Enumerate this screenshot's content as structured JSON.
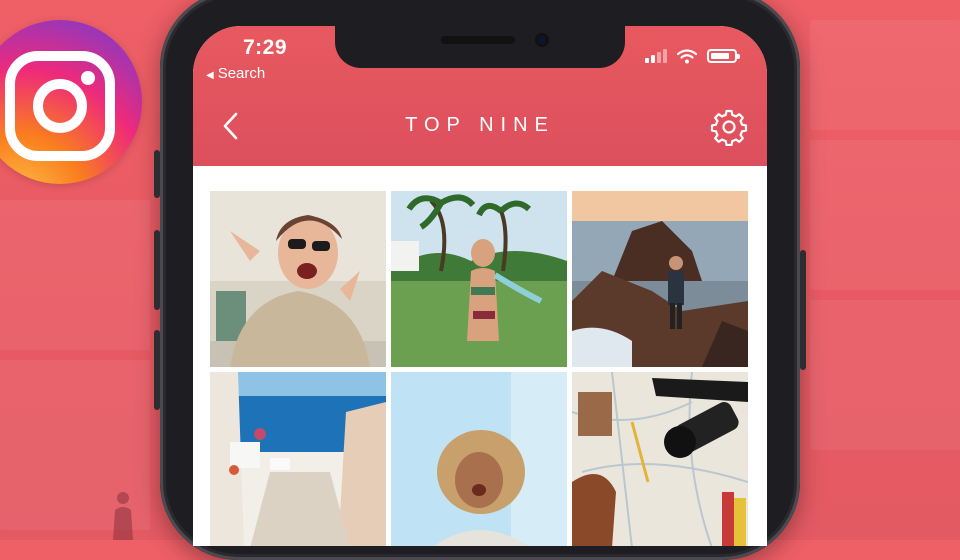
{
  "status_bar": {
    "time": "7:29",
    "back_app_label": "Search",
    "battery_level": 0.8
  },
  "header": {
    "title": "TOP NINE"
  },
  "icons": {
    "logo": "instagram-icon",
    "back": "chevron-left-icon",
    "settings": "gear-icon",
    "wifi": "wifi-icon",
    "signal": "cellular-signal-icon",
    "battery": "battery-icon"
  },
  "colors": {
    "background": "#ee5f66",
    "header": "#e8595f",
    "phone_frame": "#1e1e22"
  },
  "grid": {
    "photos": [
      {
        "name": "photo-woman-sunglasses"
      },
      {
        "name": "photo-woman-bikini-palms"
      },
      {
        "name": "photo-hiker-coast-rocks"
      },
      {
        "name": "photo-santorini-street"
      },
      {
        "name": "photo-curly-hair-woman"
      },
      {
        "name": "photo-map-camera-flatlay"
      }
    ]
  }
}
